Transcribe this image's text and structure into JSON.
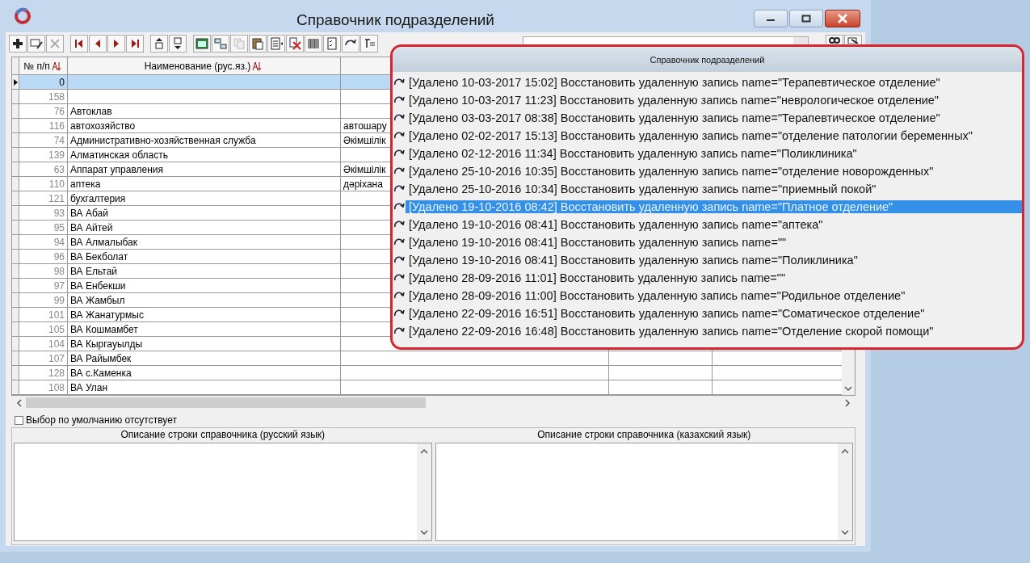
{
  "window": {
    "title": "Справочник подразделений"
  },
  "table": {
    "columns": [
      "№ п/п",
      "Наименование (рус.яз.)"
    ],
    "rows": [
      {
        "num": "0",
        "selected": true
      },
      {
        "num": "158",
        "selected": false
      },
      {
        "num": "76",
        "name": "Автоклав",
        "selected": false
      },
      {
        "num": "116",
        "name": "автохозяйство",
        "column_3": "автошару",
        "selected": false
      },
      {
        "num": "74",
        "name": "Административно-хозяйственная служба",
        "column_3": "Әкімшілік",
        "selected": false
      },
      {
        "num": "139",
        "name": "Алматинская область",
        "selected": false
      },
      {
        "num": "63",
        "name": "Аппарат управления",
        "column_3": "Әкімшілік",
        "selected": false
      },
      {
        "num": "110",
        "name": "аптека",
        "column_3": "дәріхана",
        "selected": false
      },
      {
        "num": "121",
        "name": "бухгалтерия",
        "selected": false
      },
      {
        "num": "93",
        "name": "ВА Абай",
        "selected": false
      },
      {
        "num": "95",
        "name": "ВА Айтей",
        "selected": false
      },
      {
        "num": "94",
        "name": "ВА Алмалыбак",
        "selected": false
      },
      {
        "num": "96",
        "name": "ВА Бекболат",
        "selected": false
      },
      {
        "num": "98",
        "name": "ВА Ельтай",
        "selected": false
      },
      {
        "num": "97",
        "name": "ВА Енбекши",
        "selected": false
      },
      {
        "num": "99",
        "name": "ВА Жамбыл",
        "selected": false
      },
      {
        "num": "101",
        "name": "ВА Жанатурмыс",
        "selected": false
      },
      {
        "num": "105",
        "name": "ВА Кошмамбет",
        "selected": false
      },
      {
        "num": "104",
        "name": "ВА Кыргауылды",
        "selected": false
      },
      {
        "num": "107",
        "name": "ВА Райымбек",
        "selected": false
      },
      {
        "num": "128",
        "name": "ВА с.Каменка",
        "selected": false
      },
      {
        "num": "108",
        "name": "ВА Улан",
        "selected": false
      }
    ]
  },
  "default_choice": {
    "label": "Выбор по умолчанию отсутствует",
    "checked": false
  },
  "descriptions": [
    {
      "title": "Описание строки справочника (русский язык)"
    },
    {
      "title": "Описание строки справочника (казахский язык)"
    }
  ],
  "popup": {
    "title": "Справочник подразделений",
    "items": [
      {
        "text": "[Удалено 10-03-2017 15:02] Восстановить удаленную запись name=\"Терапевтическое отделение\"",
        "selected": false
      },
      {
        "text": "[Удалено 10-03-2017 11:23] Восстановить удаленную запись name=\"неврологическое отделение\"",
        "selected": false
      },
      {
        "text": "[Удалено 03-03-2017 08:38] Восстановить удаленную запись name=\"Терапевтическое отделение\"",
        "selected": false
      },
      {
        "text": "[Удалено 02-02-2017 15:13] Восстановить удаленную запись name=\"отделение патологии беременных\"",
        "selected": false
      },
      {
        "text": "[Удалено 02-12-2016 11:34] Восстановить удаленную запись name=\"Поликлиника\"",
        "selected": false
      },
      {
        "text": "[Удалено 25-10-2016 10:35] Восстановить удаленную запись name=\"отделение новорожденных\"",
        "selected": false
      },
      {
        "text": "[Удалено 25-10-2016 10:34] Восстановить удаленную запись name=\"приемный покой\"",
        "selected": false
      },
      {
        "text": "[Удалено 19-10-2016 08:42] Восстановить удаленную запись name=\"Платное отделение\"",
        "selected": true
      },
      {
        "text": "[Удалено 19-10-2016 08:41] Восстановить удаленную запись name=\"аптека\"",
        "selected": false
      },
      {
        "text": "[Удалено 19-10-2016 08:41] Восстановить удаленную запись name=\"\"",
        "selected": false
      },
      {
        "text": "[Удалено 19-10-2016 08:41] Восстановить удаленную запись name=\"Поликлиника\"",
        "selected": false
      },
      {
        "text": "[Удалено 28-09-2016 11:01] Восстановить удаленную запись name=\"\"",
        "selected": false
      },
      {
        "text": "[Удалено 28-09-2016 11:00] Восстановить удаленную запись name=\"Родильное отделение\"",
        "selected": false
      },
      {
        "text": "[Удалено 22-09-2016 16:51] Восстановить удаленную запись name=\"Соматическое отделение\"",
        "selected": false
      },
      {
        "text": "[Удалено 22-09-2016 16:48] Восстановить удаленную запись name=\"Отделение скорой помощи\"",
        "selected": false
      }
    ]
  }
}
